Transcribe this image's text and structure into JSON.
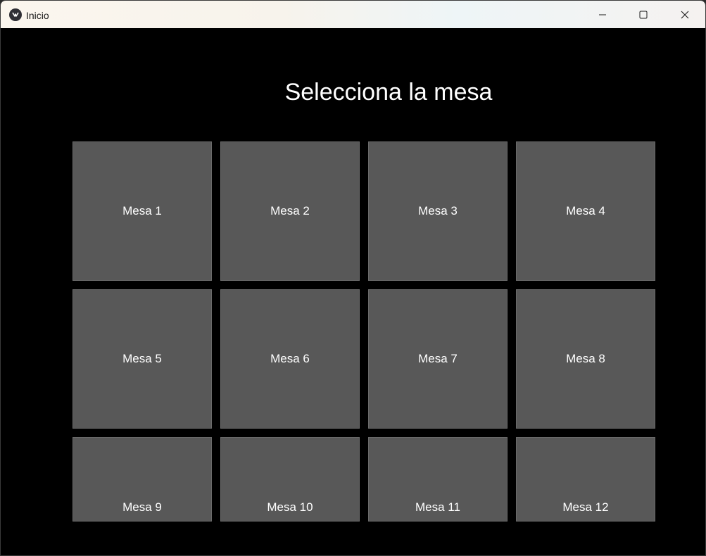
{
  "window": {
    "title": "Inicio"
  },
  "screen": {
    "heading": "Selecciona la mesa"
  },
  "tables": [
    {
      "label": "Mesa 1"
    },
    {
      "label": "Mesa 2"
    },
    {
      "label": "Mesa 3"
    },
    {
      "label": "Mesa 4"
    },
    {
      "label": "Mesa 5"
    },
    {
      "label": "Mesa 6"
    },
    {
      "label": "Mesa 7"
    },
    {
      "label": "Mesa 8"
    },
    {
      "label": "Mesa 9"
    },
    {
      "label": "Mesa 10"
    },
    {
      "label": "Mesa 11"
    },
    {
      "label": "Mesa 12"
    }
  ],
  "colors": {
    "background": "#000000",
    "tile": "#585858",
    "text": "#ffffff"
  },
  "icons": {
    "app": "kivy-app-icon",
    "minimize": "minimize-icon",
    "maximize": "maximize-icon",
    "close": "close-icon"
  }
}
